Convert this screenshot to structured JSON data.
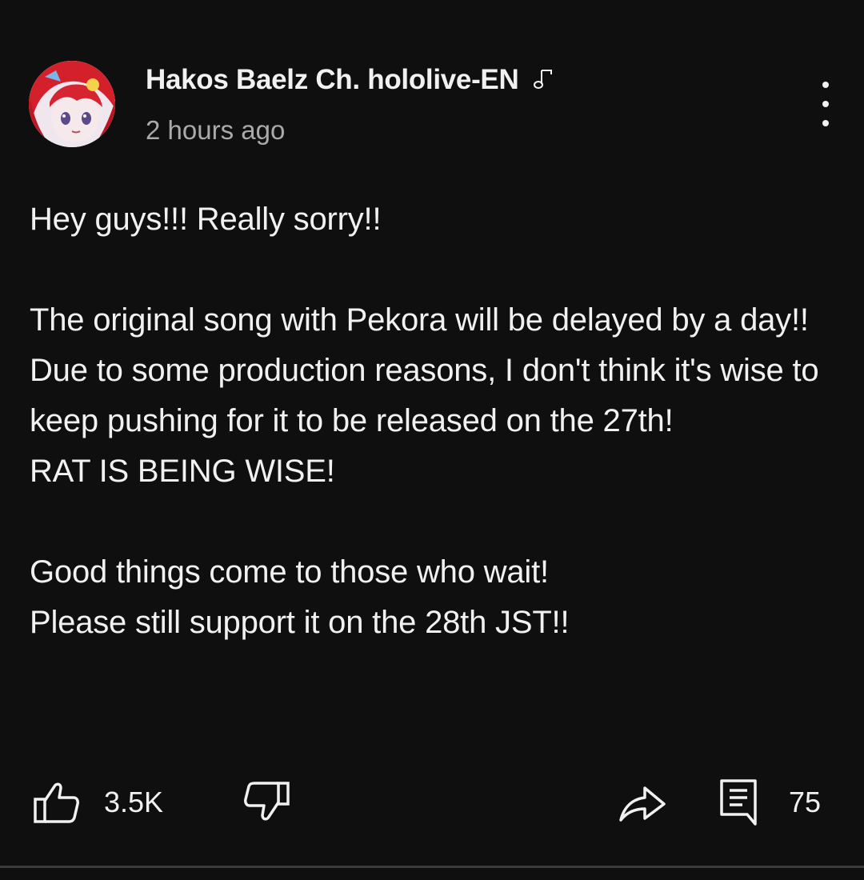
{
  "post": {
    "channel_name": "Hakos Baelz Ch. hololive-EN",
    "timestamp": "2 hours ago",
    "body": "Hey guys!!! Really sorry!!\n\nThe original song with Pekora will be delayed by a day!!\nDue to some production reasons, I don't think it's wise to keep pushing for it to be released on the 27th!\nRAT IS BEING WISE!\n\nGood things come to those who wait!\nPlease still support it on the 28th JST!!",
    "like_count": "3.5K",
    "comment_count": "75"
  },
  "icons": {
    "avatar": "channel-avatar",
    "badge": "music-note-icon",
    "more": "more-vertical-icon",
    "like": "thumbs-up-icon",
    "dislike": "thumbs-down-icon",
    "share": "share-arrow-icon",
    "comments": "comment-icon"
  },
  "colors": {
    "background": "#0f0f0f",
    "text": "#f1f1f1",
    "secondary_text": "#aaaaaa"
  }
}
